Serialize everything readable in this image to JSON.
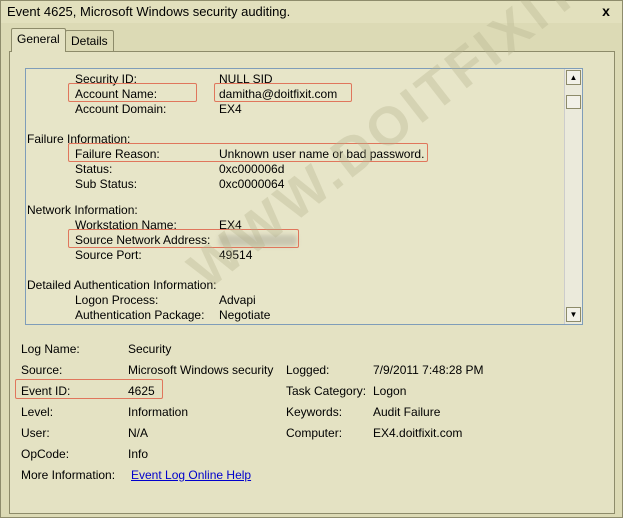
{
  "window": {
    "title": "Event 4625, Microsoft Windows security auditing.",
    "close_label": "x"
  },
  "tabs": [
    {
      "label": "General"
    },
    {
      "label": "Details"
    }
  ],
  "description": {
    "subject": {
      "security_id_label": "Security ID:",
      "security_id": "NULL SID",
      "account_name_label": "Account Name:",
      "account_name": "damitha@doitfixit.com",
      "account_domain_label": "Account Domain:",
      "account_domain": "EX4"
    },
    "failure": {
      "section_label": "Failure Information:",
      "failure_reason_label": "Failure Reason:",
      "failure_reason": "Unknown user name or bad password.",
      "status_label": "Status:",
      "status": "0xc000006d",
      "sub_status_label": "Sub Status:",
      "sub_status": "0xc0000064"
    },
    "network": {
      "section_label": "Network Information:",
      "workstation_label": "Workstation Name:",
      "workstation": "EX4",
      "source_address_label": "Source Network Address:",
      "source_port_label": "Source Port:",
      "source_port": "49514"
    },
    "auth": {
      "section_label": "Detailed Authentication Information:",
      "logon_process_label": "Logon Process:",
      "logon_process": "Advapi",
      "auth_package_label": "Authentication Package:",
      "auth_package": "Negotiate"
    }
  },
  "properties": {
    "log_name_label": "Log Name:",
    "log_name": "Security",
    "source_label": "Source:",
    "source": "Microsoft Windows security",
    "logged_label": "Logged:",
    "logged": "7/9/2011 7:48:28 PM",
    "event_id_label": "Event ID:",
    "event_id": "4625",
    "task_category_label": "Task Category:",
    "task_category": "Logon",
    "level_label": "Level:",
    "level": "Information",
    "keywords_label": "Keywords:",
    "keywords": "Audit Failure",
    "user_label": "User:",
    "user": "N/A",
    "computer_label": "Computer:",
    "computer": "EX4.doitfixit.com",
    "opcode_label": "OpCode:",
    "opcode": "Info",
    "more_info_label": "More Information:",
    "more_info_link": "Event Log Online Help"
  },
  "watermark": "WWW.DOITFIXIT.COM",
  "colors": {
    "highlight": "#e0765c",
    "background": "#dcdab5",
    "link": "#0000cc"
  }
}
